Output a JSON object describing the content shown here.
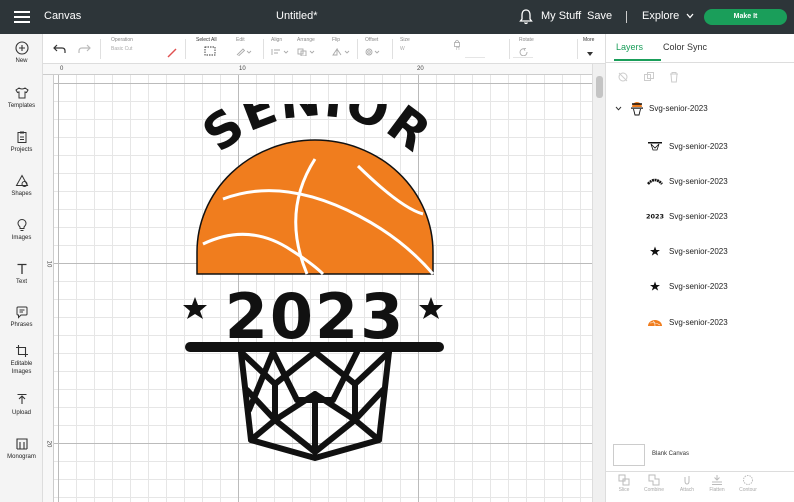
{
  "topbar": {
    "menu_icon": "hamburger-icon",
    "app_title": "Canvas",
    "doc_title": "Untitled*",
    "notification_icon": "bell-icon",
    "my_stuff": "My Stuff",
    "save": "Save",
    "separator": "|",
    "explore": "Explore",
    "make_it": "Make It",
    "accent_color": "#1a9e5a"
  },
  "sidebar": {
    "items": [
      {
        "label": "New",
        "icon": "plus-circle-icon"
      },
      {
        "label": "Templates",
        "icon": "shirt-icon"
      },
      {
        "label": "Projects",
        "icon": "clipboard-icon"
      },
      {
        "label": "Shapes",
        "icon": "shapes-icon"
      },
      {
        "label": "Images",
        "icon": "lightbulb-icon"
      },
      {
        "label": "Text",
        "icon": "text-icon"
      },
      {
        "label": "Phrases",
        "icon": "speech-bubble-icon"
      },
      {
        "label": "Editable Images",
        "icon": "crop-icon"
      },
      {
        "label": "Upload",
        "icon": "upload-icon"
      },
      {
        "label": "Monogram",
        "icon": "monogram-icon"
      }
    ]
  },
  "toolbar": {
    "operation_label": "Operation",
    "operation_value": "Basic Cut",
    "select_all": "Select All",
    "edit": "Edit",
    "align": "Align",
    "arrange": "Arrange",
    "flip": "Flip",
    "offset": "Offset",
    "size": "Size",
    "w_label": "W",
    "h_label": "H",
    "rotate": "Rotate",
    "more": "More"
  },
  "canvas": {
    "ruler_top": [
      "0",
      "10",
      "20"
    ],
    "ruler_left": [
      "10",
      "20"
    ],
    "art_text_top": "SENIOR",
    "art_text_year": "2023",
    "ball_color": "#f07d1e"
  },
  "panel": {
    "tabs": [
      "Layers",
      "Color Sync"
    ],
    "group_name": "Svg-senior-2023",
    "layers": [
      {
        "name": "Svg-senior-2023",
        "thumb": "net-icon"
      },
      {
        "name": "Svg-senior-2023",
        "thumb": "arc-text-icon"
      },
      {
        "name": "Svg-senior-2023",
        "thumb": "year-text-icon",
        "thumb_text": "2023"
      },
      {
        "name": "Svg-senior-2023",
        "thumb": "star-icon"
      },
      {
        "name": "Svg-senior-2023",
        "thumb": "star-icon"
      },
      {
        "name": "Svg-senior-2023",
        "thumb": "half-ball-icon"
      }
    ],
    "blank_canvas": "Blank Canvas",
    "bottom_actions": [
      "Slice",
      "Combine",
      "Attach",
      "Flatten",
      "Contour"
    ]
  }
}
